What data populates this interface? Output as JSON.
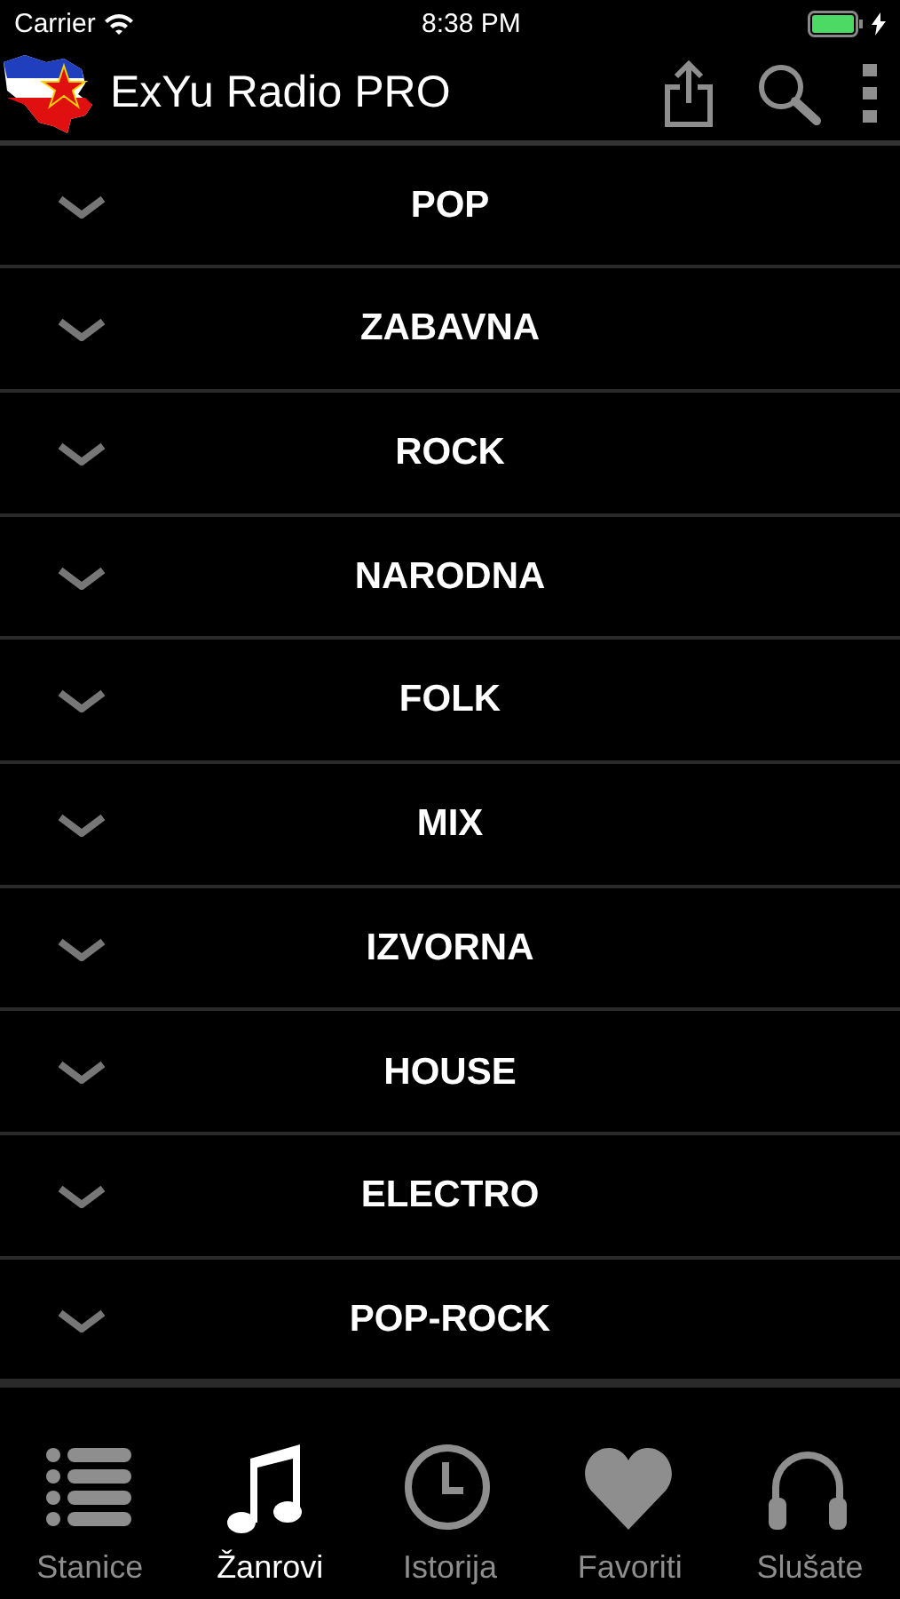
{
  "status_bar": {
    "carrier": "Carrier",
    "time": "8:38 PM",
    "battery": {
      "level": 1
    }
  },
  "app_bar": {
    "title": "ExYu Radio PRO"
  },
  "genres": [
    {
      "label": "POP",
      "expanded": false
    },
    {
      "label": "ZABAVNA",
      "expanded": false
    },
    {
      "label": "ROCK",
      "expanded": false
    },
    {
      "label": "NARODNA",
      "expanded": false
    },
    {
      "label": "FOLK",
      "expanded": false
    },
    {
      "label": "MIX",
      "expanded": false
    },
    {
      "label": "IZVORNA",
      "expanded": false
    },
    {
      "label": "HOUSE",
      "expanded": false
    },
    {
      "label": "ELECTRO",
      "expanded": false
    },
    {
      "label": "POP-ROCK",
      "expanded": false
    }
  ],
  "tab_bar": [
    {
      "label": "Stanice",
      "kind": "list",
      "selected": false
    },
    {
      "label": "Žanrovi",
      "kind": "music",
      "selected": true
    },
    {
      "label": "Istorija",
      "kind": "clock",
      "selected": false
    },
    {
      "label": "Favoriti",
      "kind": "heart",
      "selected": false
    },
    {
      "label": "Slušate",
      "kind": "headphones",
      "selected": false
    }
  ]
}
